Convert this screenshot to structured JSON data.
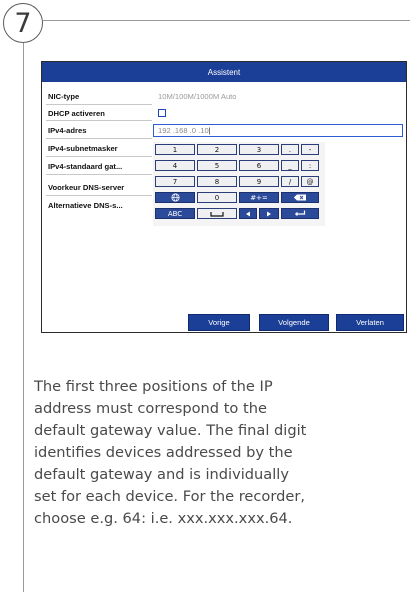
{
  "step": {
    "number": "7"
  },
  "window": {
    "title": "Assistent"
  },
  "form": {
    "nic_type": {
      "label": "NIC-type",
      "value": "10M/100M/1000M Auto"
    },
    "dhcp": {
      "label": "DHCP activeren",
      "checked": false
    },
    "ipv4_address": {
      "label": "IPv4-adres",
      "value": "192 .168 .0    .10",
      "caret": "|"
    },
    "ipv4_subnet": {
      "label": "IPv4-subnetmasker"
    },
    "ipv4_gateway": {
      "label": "IPv4-standaard gat..."
    },
    "dns_preferred": {
      "label": "Voorkeur DNS-server"
    },
    "dns_alternate": {
      "label": "Alternatieve DNS-s..."
    }
  },
  "keyboard": {
    "row1": [
      "1",
      "2",
      "3",
      ".",
      "-"
    ],
    "row2": [
      "4",
      "5",
      "6",
      "_",
      ":"
    ],
    "row3": [
      "7",
      "8",
      "9",
      "/",
      "@"
    ],
    "row4": {
      "globe_icon": "globe-icon",
      "zero": "0",
      "symbols": "#+=",
      "backspace_icon": "backspace-icon"
    },
    "row5": {
      "abc": "ABC",
      "space_icon": "space-icon",
      "left_icon": "arrow-left-icon",
      "right_icon": "arrow-right-icon",
      "enter_icon": "enter-icon"
    }
  },
  "buttons": {
    "previous": "Vorige",
    "next": "Volgende",
    "exit": "Verlaten"
  },
  "description": "The first three positions of the IP\naddress must correspond to the\ndefault gateway value. The final digit\nidentifies devices addressed by the\ndefault gateway and is individually\nset for each device. For the recorder,\nchoose e.g. 64: i.e. xxx.xxx.xxx.64.",
  "colors": {
    "titlebar": "#1b3e96",
    "input_border": "#2e5bd6",
    "text_gray": "#4a4a4a"
  }
}
